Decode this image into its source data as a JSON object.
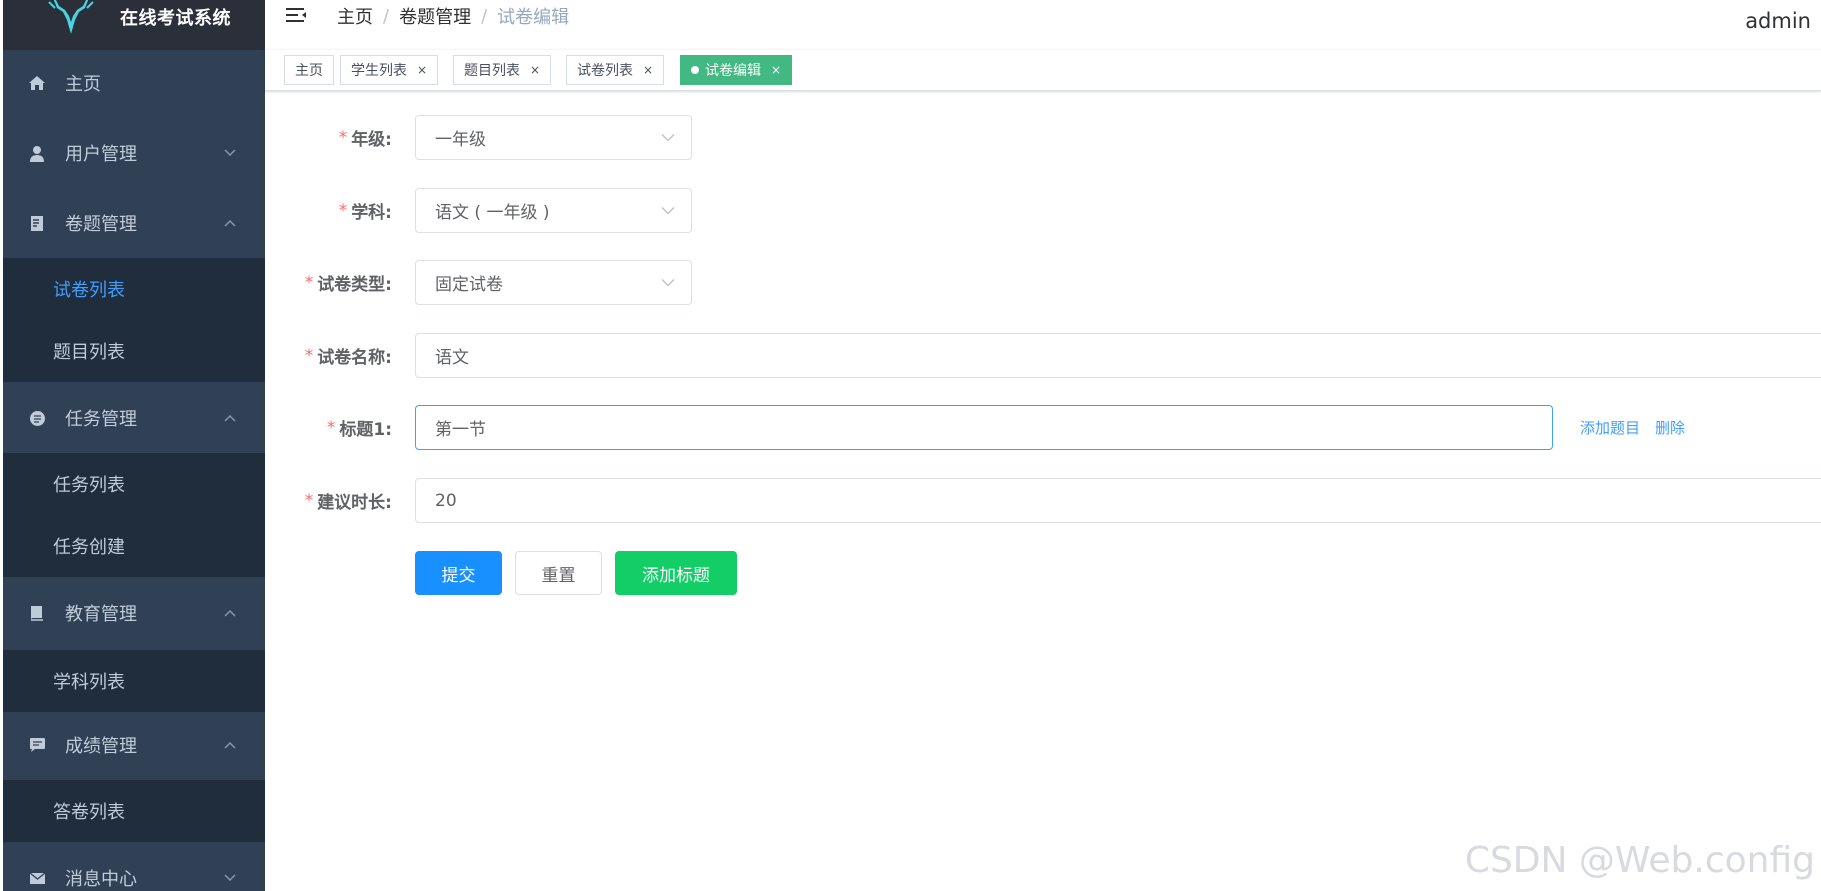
{
  "app": {
    "logo_text": "在线考试系统",
    "user_name": "admin"
  },
  "sidebar": {
    "items": [
      {
        "label": "主页",
        "icon": "home-icon"
      },
      {
        "label": "用户管理",
        "icon": "user-icon"
      },
      {
        "label": "卷题管理",
        "icon": "exam-icon",
        "children": [
          {
            "label": "试卷列表",
            "active": true
          },
          {
            "label": "题目列表"
          }
        ]
      },
      {
        "label": "任务管理",
        "icon": "task-icon",
        "children": [
          {
            "label": "任务列表"
          },
          {
            "label": "任务创建"
          }
        ]
      },
      {
        "label": "教育管理",
        "icon": "book-icon",
        "children": [
          {
            "label": "学科列表"
          }
        ]
      },
      {
        "label": "成绩管理",
        "icon": "comment-icon",
        "children": [
          {
            "label": "答卷列表"
          }
        ]
      },
      {
        "label": "消息中心",
        "icon": "message-icon"
      }
    ]
  },
  "breadcrumb": [
    "主页",
    "卷题管理",
    "试卷编辑"
  ],
  "tags": [
    "主页",
    "学生列表",
    "题目列表",
    "试卷列表",
    "试卷编辑"
  ],
  "form": {
    "grade": {
      "label": "年级:",
      "value": "一年级"
    },
    "subject": {
      "label": "学科:",
      "value": "语文 ( 一年级 )"
    },
    "paper_type": {
      "label": "试卷类型:",
      "value": "固定试卷"
    },
    "paper_name": {
      "label": "试卷名称:",
      "value": "语文"
    },
    "title1": {
      "label": "标题1:",
      "value": "第一节",
      "add_question": "添加题目",
      "delete": "删除"
    },
    "duration": {
      "label": "建议时长:",
      "value": "20"
    },
    "buttons": {
      "submit": "提交",
      "reset": "重置",
      "add_title": "添加标题"
    }
  },
  "watermark": "CSDN @Web.config",
  "colors": {
    "sidebar_bg": "#304156",
    "submenu_bg": "#1f2d3d",
    "active_link": "#409eff",
    "active_tag": "#42b983",
    "primary": "#1890ff",
    "success": "#13ce66"
  }
}
